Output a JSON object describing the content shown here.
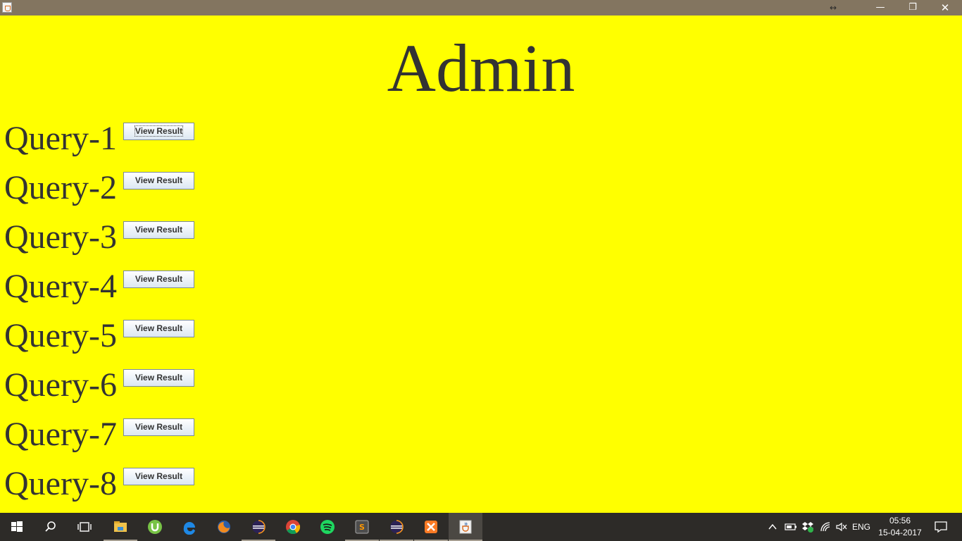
{
  "window": {
    "title": "",
    "icons": {
      "app": "java-icon",
      "resize": "resize-arrows-icon",
      "minimize": "minimize-icon",
      "restore": "restore-icon",
      "close": "close-icon"
    },
    "glyphs": {
      "resize": "↔",
      "minimize": "—",
      "restore": "❐",
      "close": "✕"
    }
  },
  "main": {
    "title": "Admin",
    "background_color": "#ffff00",
    "text_color": "#333333",
    "queries": [
      {
        "label": "Query-1",
        "button": "View Result"
      },
      {
        "label": "Query-2",
        "button": "View Result"
      },
      {
        "label": "Query-3",
        "button": "View Result"
      },
      {
        "label": "Query-4",
        "button": "View Result"
      },
      {
        "label": "Query-5",
        "button": "View Result"
      },
      {
        "label": "Query-6",
        "button": "View Result"
      },
      {
        "label": "Query-7",
        "button": "View Result"
      },
      {
        "label": "Query-8",
        "button": "View Result"
      }
    ]
  },
  "taskbar": {
    "apps": [
      "windows-start-icon",
      "search-icon",
      "task-view-icon",
      "file-explorer-icon",
      "utorrent-icon",
      "edge-icon",
      "firefox-icon",
      "eclipse-icon",
      "chrome-icon",
      "spotify-icon",
      "sublime-text-icon",
      "eclipse-icon",
      "xampp-icon",
      "java-icon"
    ],
    "tray": {
      "language": "ENG",
      "time": "05:56",
      "date": "15-04-2017"
    }
  }
}
